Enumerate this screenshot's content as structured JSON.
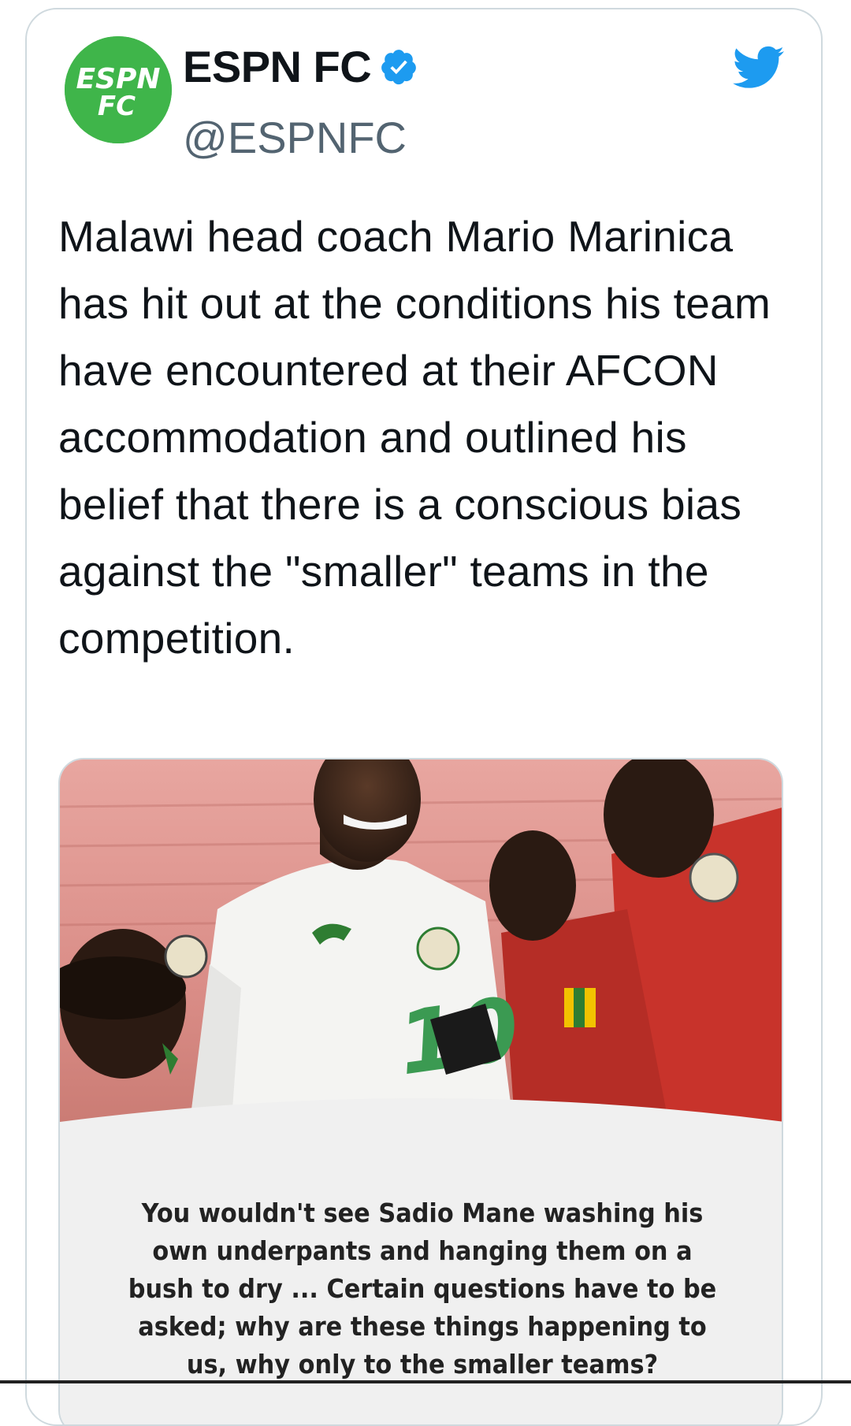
{
  "tweet": {
    "author": {
      "display_name": "ESPN FC",
      "handle": "@ESPNFC",
      "verified": true,
      "avatar_text_top": "ESPN",
      "avatar_text_bottom": "FC",
      "avatar_color": "#3fb54a"
    },
    "text": "Malawi head coach Mario Marinica has hit out at the conditions his team have encountered at their AFCON accommodation and outlined his belief that there is a conscious bias against the \"smaller\" teams in the competition.",
    "media": {
      "jersey_number": "10",
      "quote": "You wouldn't see Sadio Mane washing his own underpants and hanging them on a bush to dry ... Certain questions have to be asked; why are these things happening to us, why only to the smaller teams?"
    }
  },
  "colors": {
    "twitter_blue": "#1d9bf0",
    "text_primary": "#0f1419",
    "text_secondary": "#536471",
    "border": "#cfd9de"
  },
  "icons": {
    "verified": "verified-badge-icon",
    "brand": "twitter-bird-icon"
  }
}
